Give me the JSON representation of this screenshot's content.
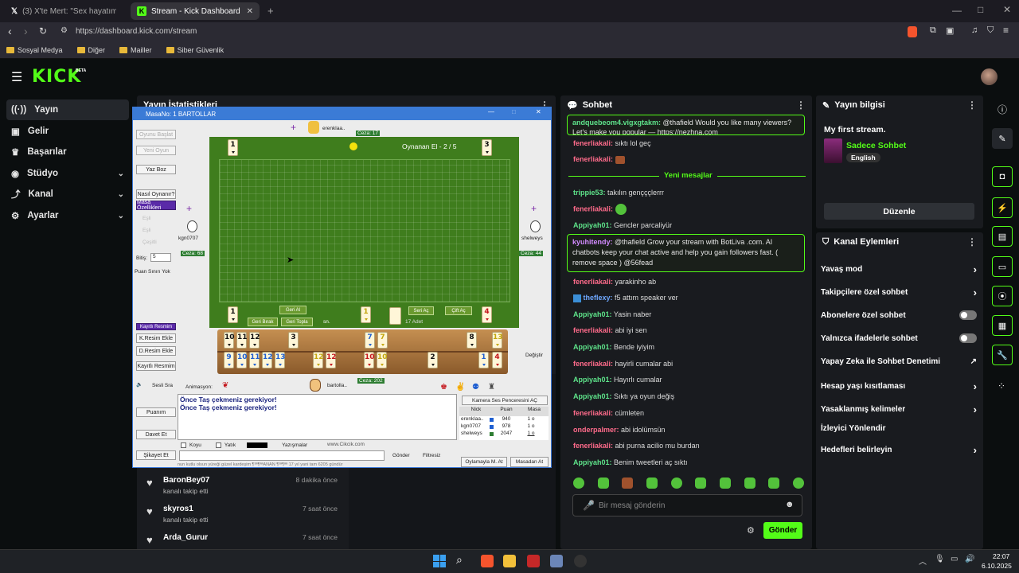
{
  "browser": {
    "tabs": [
      {
        "label": "(3) X'te Mert: \"Sex hayatımızda h"
      },
      {
        "label": "Stream - Kick Dashboard"
      }
    ],
    "url_host": "https://dashboard.kick.com/stream",
    "bookmarks": [
      "Sosyal Medya",
      "Diğer",
      "Mailler",
      "Siber Güvenlik"
    ]
  },
  "app": {
    "logo": "KICK",
    "logo_badge": "BETA",
    "sidebar": [
      {
        "label": "Yayın",
        "active": true
      },
      {
        "label": "Gelir"
      },
      {
        "label": "Başarılar"
      },
      {
        "label": "Stüdyo",
        "chevron": true
      },
      {
        "label": "Kanal",
        "chevron": true
      },
      {
        "label": "Ayarlar",
        "chevron": true
      }
    ],
    "stats_title": "Yayın İstatistikleri",
    "activity": [
      {
        "name": "BaronBey07",
        "time": "8 dakika önce",
        "action": "kanalı takip etti"
      },
      {
        "name": "skyros1",
        "time": "7 saat önce",
        "action": "kanalı takip etti"
      },
      {
        "name": "Arda_Gurur",
        "time": "7 saat önce",
        "action": ""
      }
    ]
  },
  "chat": {
    "title": "Sohbet",
    "top_partial": "@thafield Would you like many viewers? Let's make you popular — https://nezhna.com",
    "top_partial_user": "andquebeom4.vigxgtakm:",
    "new_messages": "Yeni mesajlar",
    "messages": [
      {
        "user": "fenerliakali:",
        "text": "sıktı lol geç",
        "color": "red"
      },
      {
        "user": "fenerliakali:",
        "text": "",
        "color": "red",
        "emote": true
      },
      {
        "user": "trippie53:",
        "text": "takılın gençççlerrr",
        "color": "green"
      },
      {
        "user": "fenerliakali:",
        "text": "",
        "color": "red",
        "emote": true
      },
      {
        "user": "Appiyah01:",
        "text": "Gencler parcaliyür",
        "color": "green"
      },
      {
        "user": "kyuhitendy:",
        "text": "@thafield Grow your stream with BotLiva .com. AI chatbots keep your chat active and help you gain followers fast. ( remove space ) @56fead",
        "color": "purple"
      },
      {
        "user": "fenerliakali:",
        "text": "yarakinho ab",
        "color": "red"
      },
      {
        "user": "theflexy:",
        "text": "f5 attım speaker ver",
        "color": "blue"
      },
      {
        "user": "Appiyah01:",
        "text": "Yasin naber",
        "color": "green"
      },
      {
        "user": "fenerliakali:",
        "text": "abi iyi sen",
        "color": "red"
      },
      {
        "user": "Appiyah01:",
        "text": "Bende iyiyim",
        "color": "green"
      },
      {
        "user": "fenerliakali:",
        "text": "hayirli cumalar abi",
        "color": "red"
      },
      {
        "user": "Appiyah01:",
        "text": "Hayırlı cumalar",
        "color": "green"
      },
      {
        "user": "Appiyah01:",
        "text": "Sıktı ya oyun değiş",
        "color": "green"
      },
      {
        "user": "fenerliakali:",
        "text": "cümleten",
        "color": "red"
      },
      {
        "user": "onderpalmer:",
        "text": "abi idolümsün",
        "color": "red"
      },
      {
        "user": "fenerliakali:",
        "text": "abi purna acilio mu burdan",
        "color": "red"
      },
      {
        "user": "Appiyah01:",
        "text": "Benim tweetleri aç sıktı",
        "color": "green"
      }
    ],
    "input_placeholder": "Bir mesaj gönderin",
    "send_label": "Gönder"
  },
  "stream_info": {
    "title": "Yayın bilgisi",
    "stream_title": "My first stream.",
    "category": "Sadece Sohbet",
    "language": "English",
    "edit_label": "Düzenle"
  },
  "channel_actions": {
    "title": "Kanal Eylemleri",
    "items": [
      {
        "label": "Yavaş mod",
        "kind": "chevron"
      },
      {
        "label": "Takipçilere özel sohbet",
        "kind": "chevron"
      },
      {
        "label": "Abonelere özel sohbet",
        "kind": "toggle",
        "on": false
      },
      {
        "label": "Yalnızca ifadelerle sohbet",
        "kind": "toggle",
        "on": false
      },
      {
        "label": "Yapay Zeka ile Sohbet Denetimi",
        "kind": "external"
      },
      {
        "label": "Hesap yaşı kısıtlaması",
        "kind": "chevron"
      },
      {
        "label": "Yasaklanmış kelimeler",
        "kind": "chevron"
      },
      {
        "label": "İzleyici Yönlendir",
        "kind": "none"
      },
      {
        "label": "Hedefleri belirleyin",
        "kind": "chevron"
      }
    ]
  },
  "game": {
    "window_title": "MasaNo: 1  BARTOLLAR",
    "left_buttons": [
      "Oyunu Başlat",
      "Yeni Oyun",
      "Yaz Boz",
      "Nasıl Oynanır?",
      "Masa Özellikleri"
    ],
    "options": [
      "Eşli",
      "Eşli",
      "Çeşitli"
    ],
    "bitis_label": "Bitiş:",
    "bitis_value": "5",
    "puan_label": "Puan Sınırı Yok",
    "kayitli": "Kayıtlı Resmim",
    "kresim": "K.Resim Ekle",
    "dresim": "D.Resim Ekle",
    "kayitli2": "Kayıtlı Resmim",
    "sesli": "Sesli Sra",
    "puanim": "Puanım",
    "davet": "Davet Et",
    "sikayet": "Şikayet Et",
    "players": {
      "top": "erenklaa..",
      "left": "kgn0707",
      "right": "shelweys",
      "bottom": "bartolla.."
    },
    "penalties": {
      "top": "Ceza: 17",
      "left": "Ceza: 68",
      "right": "Ceza: 44",
      "bottom": "Ceza: 202"
    },
    "round_label": "Oynanan El - 2 / 5",
    "corner_tiles": [
      "1",
      "3",
      "1",
      "4"
    ],
    "discard_tiles": [
      "1"
    ],
    "board_buttons": [
      "Geri Al",
      "Geri Bırak",
      "Geri Topla",
      "Seri Aç",
      "Çift Aç"
    ],
    "sn_label": "sn.",
    "adet": "17 Adet",
    "rack_top": [
      {
        "n": "10",
        "c": "black"
      },
      {
        "n": "11",
        "c": "black"
      },
      {
        "n": "12",
        "c": "black"
      },
      {
        "n": "3",
        "c": "black"
      },
      {
        "n": "7",
        "c": "blue"
      },
      {
        "n": "7",
        "c": "yellow"
      },
      {
        "n": "8",
        "c": "black"
      },
      {
        "n": "13",
        "c": "yellow"
      }
    ],
    "rack_bottom": [
      {
        "n": "9",
        "c": "blue"
      },
      {
        "n": "10",
        "c": "blue"
      },
      {
        "n": "11",
        "c": "blue"
      },
      {
        "n": "12",
        "c": "blue"
      },
      {
        "n": "13",
        "c": "blue"
      },
      {
        "n": "12",
        "c": "yellow"
      },
      {
        "n": "12",
        "c": "red"
      },
      {
        "n": "10",
        "c": "red"
      },
      {
        "n": "10",
        "c": "yellow"
      },
      {
        "n": "2",
        "c": "black"
      },
      {
        "n": "1",
        "c": "blue"
      },
      {
        "n": "4",
        "c": "red"
      }
    ],
    "degistir": "Değiştir",
    "animasyon": "Animasyon:",
    "alerts": [
      "Önce Taş çekmeniz gerekiyor!",
      "Önce Taş çekmeniz gerekiyor!"
    ],
    "kamera": "Kamera Ses Penceresini AÇ",
    "score_headers": [
      "Nick",
      "Puan",
      "Masa"
    ],
    "scores": [
      {
        "nick": "erenklaa..",
        "puan": "940",
        "masa": "1 o"
      },
      {
        "nick": "kgn0707",
        "puan": "978",
        "masa": "1 o"
      },
      {
        "nick": "shelweys",
        "puan": "2047",
        "masa": "1 o"
      }
    ],
    "chat_opts": [
      "Koyu",
      "Yatık",
      "Yazışmalar"
    ],
    "site": "www.Cikcik.com",
    "gonder": "Gönder",
    "filtresiz": "Filtresiz",
    "ticker": "nun kutlu olsun yüreği güzel kardeşim ¶³ª¶ªªANAÑ ¶³ª¶ªª 17 yıl yani tam 6205 gündür",
    "oylama": "Oylamayla M. At",
    "masadan": "Masadan At"
  },
  "taskbar": {
    "time": "22:07",
    "date": "6.10.2025"
  },
  "colors": {
    "kick_green": "#53fc18",
    "panel": "#191b1f",
    "board_green": "#3f7d1d"
  }
}
